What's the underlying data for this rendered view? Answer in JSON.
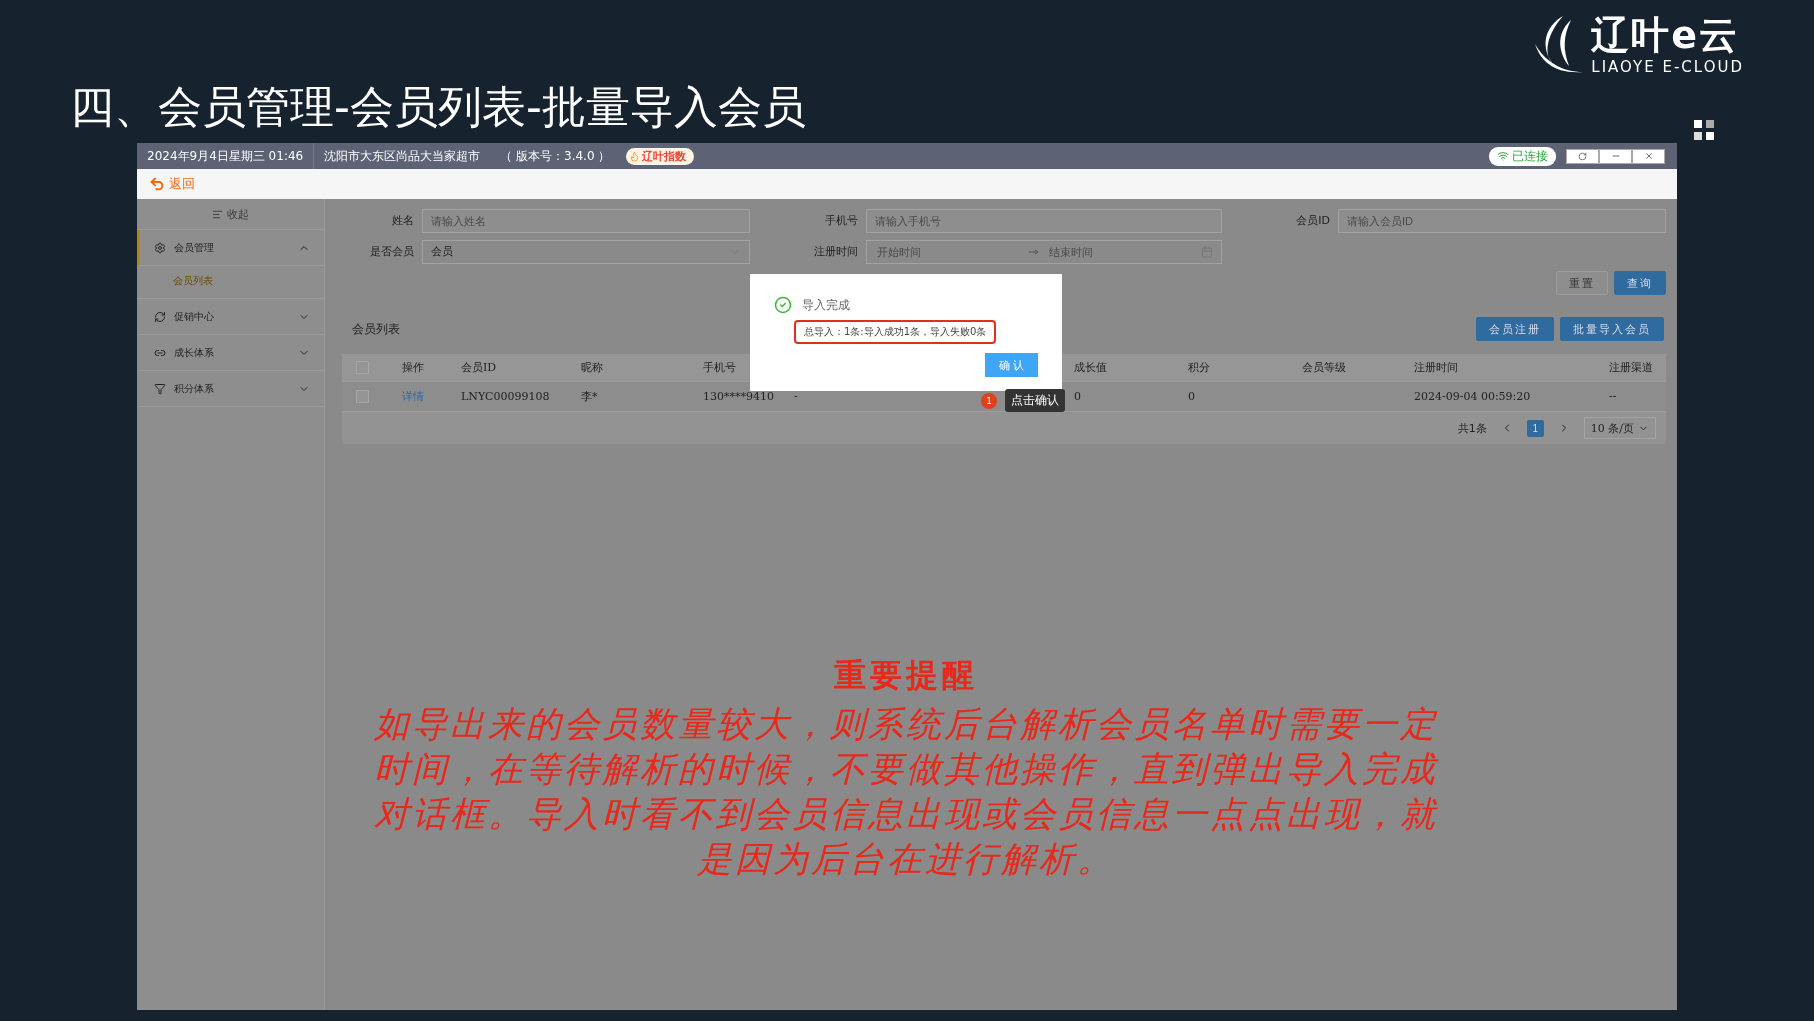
{
  "slide": {
    "title": "四、会员管理-会员列表-批量导入会员",
    "logo": {
      "name": "辽叶e云",
      "tagline": "LIAOYE E-CLOUD"
    }
  },
  "app": {
    "title_bar": {
      "datetime": "2024年9月4日星期三 01:46",
      "store": "沈阳市大东区尚品大当家超市",
      "version": "（ 版本号：3.4.0 ）",
      "badge": "辽叶指数",
      "connection": "已连接"
    },
    "back": "返回",
    "sidebar": {
      "collapse": "收起",
      "items": [
        {
          "kind": "gear",
          "label": "会员管理",
          "expanded": true,
          "children": [
            {
              "label": "会员列表",
              "selected": true
            }
          ]
        },
        {
          "kind": "cycle",
          "label": "促销中心",
          "expanded": false
        },
        {
          "kind": "link",
          "label": "成长体系",
          "expanded": false
        },
        {
          "kind": "funnel",
          "label": "积分体系",
          "expanded": false
        }
      ]
    },
    "filters": [
      {
        "kind": "text",
        "label": "姓名",
        "placeholder": "请输入姓名"
      },
      {
        "kind": "text",
        "label": "手机号",
        "placeholder": "请输入手机号"
      },
      {
        "kind": "text",
        "label": "会员ID",
        "placeholder": "请输入会员ID"
      },
      {
        "kind": "select",
        "label": "是否会员",
        "value": "会员"
      },
      {
        "kind": "daterange",
        "label": "注册时间",
        "start_placeholder": "开始时间",
        "end_placeholder": "结束时间"
      }
    ],
    "filter_buttons": [
      {
        "label": "重置",
        "kind": "plain"
      },
      {
        "label": "查询",
        "kind": "primary"
      }
    ],
    "list": {
      "title": "会员列表",
      "actions": [
        "会员注册",
        "批量导入会员"
      ],
      "select_all_checked": false,
      "columns": [
        "操作",
        "会员ID",
        "昵称",
        "手机号",
        null,
        null,
        null,
        "成长值",
        "积分",
        "会员等级",
        "注册时间",
        "注册渠道"
      ],
      "rows": [
        {
          "checked": false,
          "cells": [
            "详情",
            "LNYC00099108",
            "李*",
            "130****9410",
            "-",
            null,
            null,
            "0",
            "0",
            null,
            "2024-09-04 00:59:20",
            "--"
          ]
        }
      ],
      "pagination": {
        "total": "共1条",
        "pages": [
          {
            "label": "1",
            "selected": true
          }
        ],
        "page_size": "10 条/页"
      }
    },
    "dialog": {
      "title": "导入完成",
      "message": "总导入：1条:导入成功1条，导入失败0条",
      "confirm": "确 认"
    },
    "callout": {
      "step": "1",
      "text": "点击确认"
    },
    "notice": {
      "title": "重要提醒",
      "body": "如导出来的会员数量较大，则系统后台解析会员名单时需要一定时间，在等待解析的时候，不要做其他操作，直到弹出导入完成对话框。导入时看不到会员信息出现或会员信息一点点出现，就是因为后台在进行解析。"
    }
  }
}
